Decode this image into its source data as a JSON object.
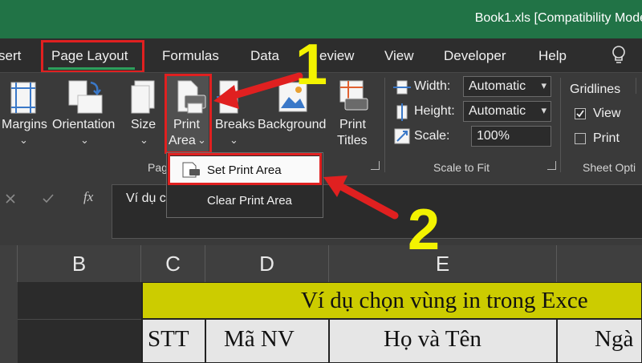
{
  "window": {
    "title": "Book1.xls  [Compatibility Mode"
  },
  "tabs": [
    "sert",
    "Page Layout",
    "Formulas",
    "Data",
    "eview",
    "View",
    "Developer",
    "Help"
  ],
  "ribbon": {
    "margins": "Margins",
    "orientation": "Orientation",
    "size": "Size",
    "print_area_1": "Print",
    "print_area_2": "Area",
    "breaks": "Breaks",
    "background": "Background",
    "print_titles_1": "Print",
    "print_titles_2": "Titles",
    "page_setup_group": "Pag",
    "width_label": "Width:",
    "width_value": "Automatic",
    "height_label": "Height:",
    "height_value": "Automatic",
    "scale_label": "Scale:",
    "scale_value": "100%",
    "scale_group": "Scale to Fit",
    "gridlines_label": "Gridlines",
    "view_label": "View",
    "print_label": "Print",
    "sheet_options_group": "Sheet Opti"
  },
  "menu": {
    "set_print_area": "Set Print Area",
    "clear_print_area": "Clear Print Area"
  },
  "formula": {
    "fx": "fx",
    "content": "Ví dụ c"
  },
  "columns": [
    "B",
    "C",
    "D",
    "E"
  ],
  "sheet": {
    "title_row": "Ví dụ chọn vùng in trong Exce",
    "headers": [
      "STT",
      "Mã NV",
      "Họ và Tên",
      "Ngà"
    ]
  },
  "annotations": [
    "1",
    "2"
  ],
  "colors": {
    "excel_green": "#217346",
    "highlight_red": "#e02020",
    "annotation_yellow": "#f3f300",
    "cell_yellow": "#cccc00"
  }
}
